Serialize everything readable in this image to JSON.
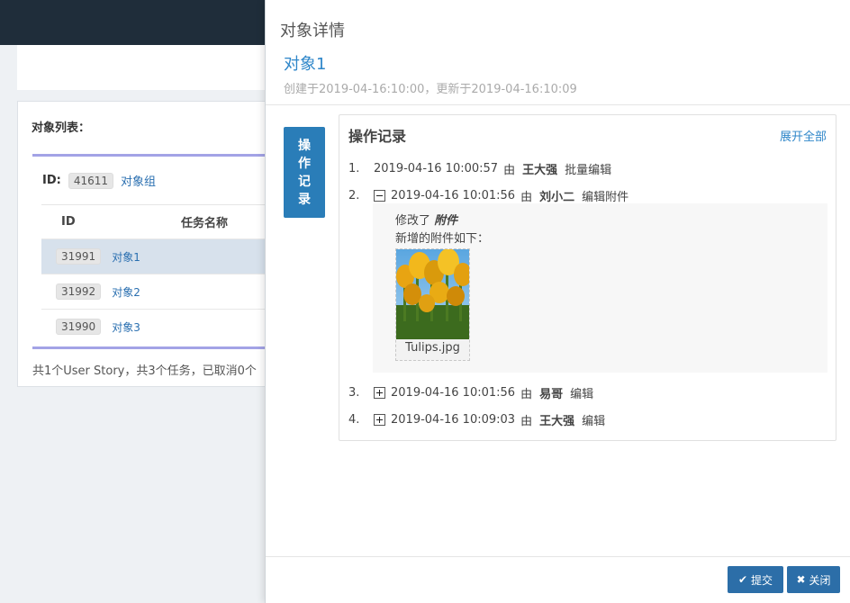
{
  "background": {
    "list_title": "对象列表：",
    "group": {
      "label": "ID:",
      "id": "41611",
      "name": "对象组"
    },
    "table": {
      "headers": [
        "ID",
        "任务名称"
      ],
      "rows": [
        {
          "id": "31991",
          "name": "对象1"
        },
        {
          "id": "31992",
          "name": "对象2"
        },
        {
          "id": "31990",
          "name": "对象3"
        }
      ]
    },
    "footer": "共1个User Story，共3个任务，已取消0个"
  },
  "drawer": {
    "title": "对象详情",
    "object_name": "对象1",
    "meta": "创建于2019-04-16:10:00，更新于2019-04-16:10:09",
    "side_tab": [
      "操",
      "作",
      "记",
      "录"
    ],
    "panel_title": "操作记录",
    "expand_all": "展开全部",
    "logs": [
      {
        "num": "1.",
        "time": "2019-04-16 10:00:57",
        "by": "由",
        "user": "王大强",
        "action": "批量编辑"
      },
      {
        "num": "2.",
        "time": "2019-04-16 10:01:56",
        "by": "由",
        "user": "刘小二",
        "action": "编辑附件"
      },
      {
        "num": "3.",
        "time": "2019-04-16 10:01:56",
        "by": "由",
        "user": "易哥",
        "action": "编辑"
      },
      {
        "num": "4.",
        "time": "2019-04-16 10:09:03",
        "by": "由",
        "user": "王大强",
        "action": "编辑"
      }
    ],
    "detail": {
      "modified_prefix": "修改了",
      "modified_field": "附件",
      "added_text": "新增的附件如下：",
      "attachment_name": "Tulips.jpg"
    },
    "buttons": {
      "submit": "提交",
      "close": "关闭"
    }
  }
}
